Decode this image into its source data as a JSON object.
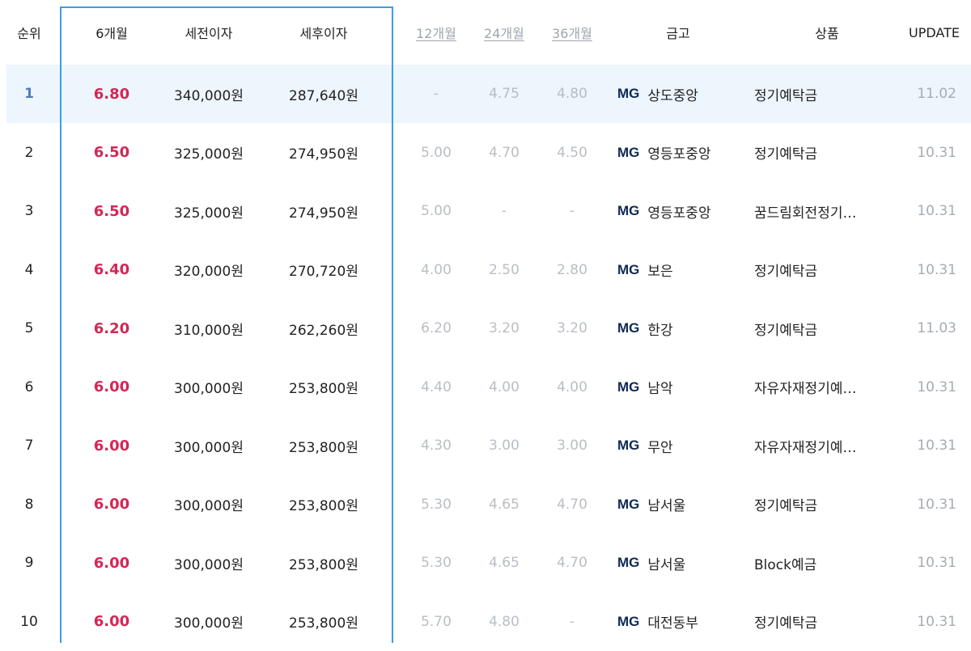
{
  "header": {
    "rank": "순위",
    "m6": "6개월",
    "pre_tax": "세전이자",
    "post_tax": "세후이자",
    "m12": "12개월",
    "m24": "24개월",
    "m36": "36개월",
    "bank": "금고",
    "product": "상품",
    "update": "UPDATE"
  },
  "bank_logo_text": "MG",
  "colors": {
    "highlight_rate": "#d42755",
    "selection_border": "#3a9fe6",
    "first_row_bg": "#edf5fd",
    "mg_logo": "#0f2a54"
  },
  "rows": [
    {
      "rank": "1",
      "m6": "6.80",
      "pre_tax": "340,000원",
      "post_tax": "287,640원",
      "m12": "-",
      "m24": "4.75",
      "m36": "4.80",
      "bank": "상도중앙",
      "product": "정기예탁금",
      "update": "11.02"
    },
    {
      "rank": "2",
      "m6": "6.50",
      "pre_tax": "325,000원",
      "post_tax": "274,950원",
      "m12": "5.00",
      "m24": "4.70",
      "m36": "4.50",
      "bank": "영등포중앙",
      "product": "정기예탁금",
      "update": "10.31"
    },
    {
      "rank": "3",
      "m6": "6.50",
      "pre_tax": "325,000원",
      "post_tax": "274,950원",
      "m12": "5.00",
      "m24": "-",
      "m36": "-",
      "bank": "영등포중앙",
      "product": "꿈드림회전정기…",
      "update": "10.31"
    },
    {
      "rank": "4",
      "m6": "6.40",
      "pre_tax": "320,000원",
      "post_tax": "270,720원",
      "m12": "4.00",
      "m24": "2.50",
      "m36": "2.80",
      "bank": "보은",
      "product": "정기예탁금",
      "update": "10.31"
    },
    {
      "rank": "5",
      "m6": "6.20",
      "pre_tax": "310,000원",
      "post_tax": "262,260원",
      "m12": "6.20",
      "m24": "3.20",
      "m36": "3.20",
      "bank": "한강",
      "product": "정기예탁금",
      "update": "11.03"
    },
    {
      "rank": "6",
      "m6": "6.00",
      "pre_tax": "300,000원",
      "post_tax": "253,800원",
      "m12": "4.40",
      "m24": "4.00",
      "m36": "4.00",
      "bank": "남악",
      "product": "자유자재정기예…",
      "update": "10.31"
    },
    {
      "rank": "7",
      "m6": "6.00",
      "pre_tax": "300,000원",
      "post_tax": "253,800원",
      "m12": "4.30",
      "m24": "3.00",
      "m36": "3.00",
      "bank": "무안",
      "product": "자유자재정기예…",
      "update": "10.31"
    },
    {
      "rank": "8",
      "m6": "6.00",
      "pre_tax": "300,000원",
      "post_tax": "253,800원",
      "m12": "5.30",
      "m24": "4.65",
      "m36": "4.70",
      "bank": "남서울",
      "product": "정기예탁금",
      "update": "10.31"
    },
    {
      "rank": "9",
      "m6": "6.00",
      "pre_tax": "300,000원",
      "post_tax": "253,800원",
      "m12": "5.30",
      "m24": "4.65",
      "m36": "4.70",
      "bank": "남서울",
      "product": "Block예금",
      "update": "10.31"
    },
    {
      "rank": "10",
      "m6": "6.00",
      "pre_tax": "300,000원",
      "post_tax": "253,800원",
      "m12": "5.70",
      "m24": "4.80",
      "m36": "-",
      "bank": "대전동부",
      "product": "정기예탁금",
      "update": "10.31"
    }
  ]
}
